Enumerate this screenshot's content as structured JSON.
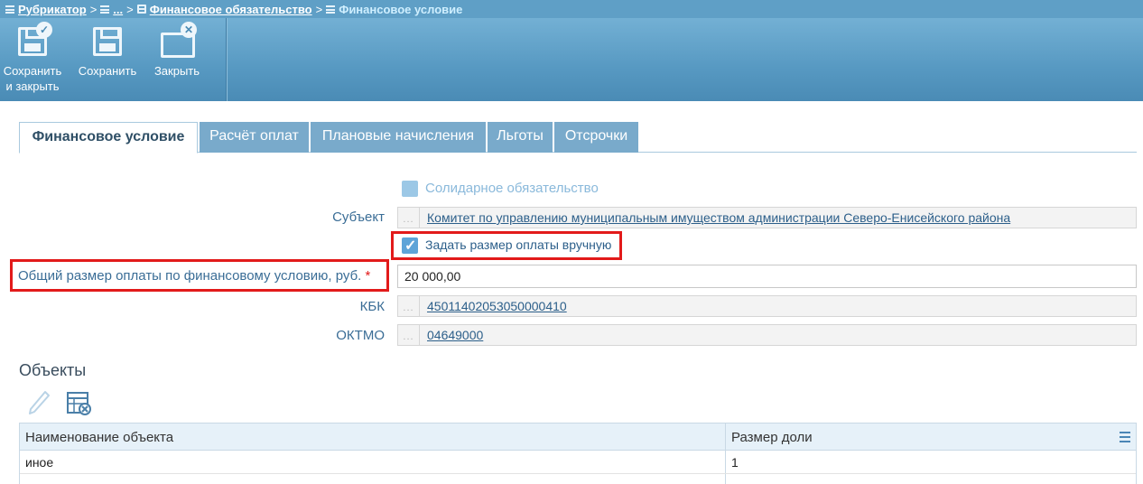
{
  "breadcrumb": {
    "items": [
      {
        "label": "Рубрикатор",
        "icon": "list-icon"
      },
      {
        "label": "...",
        "icon": "list-icon"
      },
      {
        "label": "Финансовое обязательство",
        "icon": "stack-icon"
      },
      {
        "label": "Финансовое условие",
        "icon": "list-icon"
      }
    ],
    "separator": ">"
  },
  "toolbar": {
    "save_close_line1": "Сохранить",
    "save_close_line2": "и закрыть",
    "save": "Сохранить",
    "close": "Закрыть"
  },
  "tabs": [
    {
      "label": "Финансовое условие",
      "active": true
    },
    {
      "label": "Расчёт оплат",
      "active": false
    },
    {
      "label": "Плановые начисления",
      "active": false
    },
    {
      "label": "Льготы",
      "active": false
    },
    {
      "label": "Отсрочки",
      "active": false
    }
  ],
  "form": {
    "solidary_label": "Солидарное обязательство",
    "subject_label": "Субъект",
    "subject_value": "Комитет по управлению муниципальным имуществом администрации Северо-Енисейского района",
    "manual_label": "Задать размер оплаты вручную",
    "total_label": "Общий размер оплаты по финансовому условию, руб.",
    "required_mark": "*",
    "total_value": "20 000,00",
    "kbk_label": "КБК",
    "kbk_value": "45011402053050000410",
    "oktmo_label": "ОКТМО",
    "oktmo_value": "04649000",
    "picker_dots": "..."
  },
  "objects": {
    "title": "Объекты",
    "columns": [
      "Наименование объекта",
      "Размер доли"
    ],
    "rows": [
      [
        "иное",
        "1"
      ]
    ]
  },
  "colors": {
    "accent": "#5f9fc6",
    "label": "#3a6d96",
    "highlight": "#e21a1a"
  }
}
